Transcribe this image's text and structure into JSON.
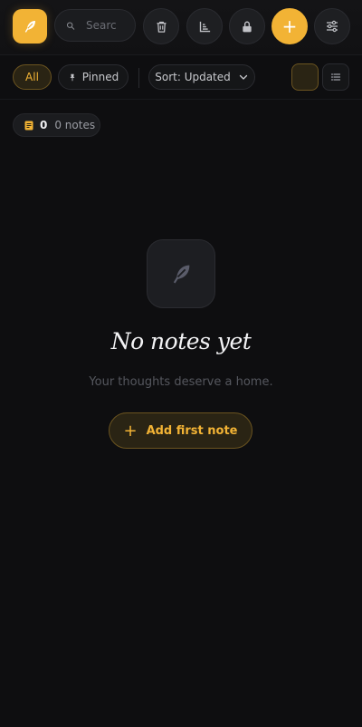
{
  "colors": {
    "accent": "#f2b335",
    "background": "#0e0e10"
  },
  "toolbar": {
    "logo_icon": "feather-icon",
    "search": {
      "placeholder": "Searc",
      "value": ""
    },
    "buttons": [
      "trash-icon",
      "chart-icon",
      "lock-icon",
      "plus-icon",
      "sliders-icon"
    ],
    "add_label": "+"
  },
  "filters": {
    "all_label": "All",
    "pinned_label": "Pinned",
    "sort_label": "Sort: Updated",
    "active": "All",
    "view_mode": "grid"
  },
  "stats": {
    "count": "0",
    "label": "0 notes"
  },
  "empty_state": {
    "title": "No notes yet",
    "subtitle": "Your thoughts deserve a home.",
    "button_label": "Add first note"
  }
}
